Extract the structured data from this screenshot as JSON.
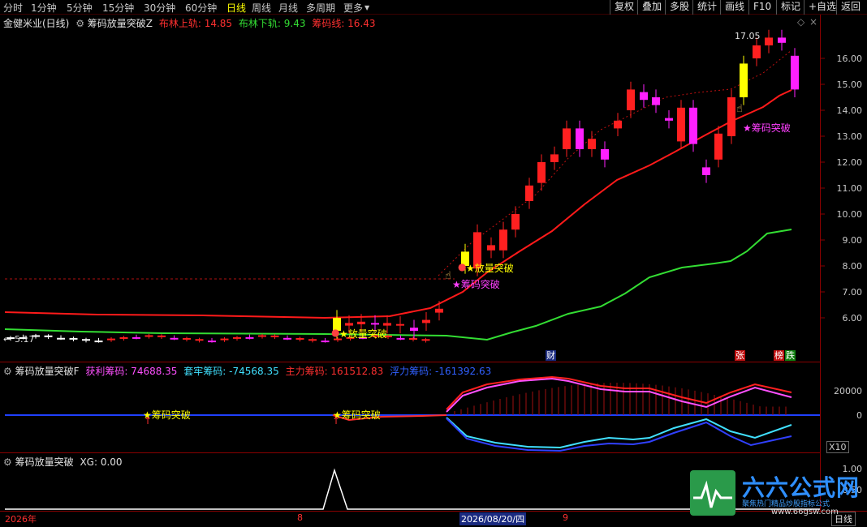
{
  "toolbar": {
    "periods": [
      "分时",
      "1分钟",
      "5分钟",
      "15分钟",
      "30分钟",
      "60分钟",
      "日线",
      "周线",
      "月线",
      "多周期",
      "更多"
    ],
    "active_period": "日线",
    "more_arrow": "▼",
    "buttons": [
      "复权",
      "叠加",
      "多股",
      "统计",
      "画线",
      "F10",
      "标记",
      "+自选",
      "返回"
    ]
  },
  "main_panel": {
    "stock_name": "金健米业(日线)",
    "indicator_name": "筹码放量突破Z",
    "upper_label": "布林上轨: 14.85",
    "lower_label": "布林下轨: 9.43",
    "chip_label": "筹码线: 16.43",
    "high_value": "17.05",
    "low_value": "5.17",
    "price_axis": [
      "16.00",
      "15.00",
      "14.00",
      "13.00",
      "12.00",
      "11.00",
      "10.00",
      "9.00",
      "8.00",
      "7.00",
      "6.00"
    ],
    "signal_volume_break": "放量突破",
    "signal_chip_break": "★筹码突破",
    "markers": {
      "cai": "财",
      "zhang": "张",
      "bang": "榜",
      "die": "跌"
    }
  },
  "panel2": {
    "indicator_name": "筹码放量突破F",
    "profit_label": "获利筹码: 74688.35",
    "trapped_label": "套牢筹码: -74568.35",
    "main_label": "主力筹码: 161512.83",
    "float_label": "浮力筹码: -161392.63",
    "axis": [
      "20000",
      "0"
    ],
    "scale": "X10",
    "signal": "★筹码突破"
  },
  "panel3": {
    "indicator_name": "筹码放量突破",
    "xg_label": "XG: 0.00",
    "axis": [
      "1.00",
      "0.50"
    ]
  },
  "bottom": {
    "dates": [
      "2026年",
      "8",
      "2026/08/20/四",
      "9"
    ],
    "period_button": "日线"
  },
  "watermark": {
    "brand": "六六公式网",
    "slogan": "聚焦热门精品炒股指标公式",
    "url": "www.66gsw.com"
  },
  "colors": {
    "up": "#ff2020",
    "down": "#ff20ff",
    "upper_band": "#ff1a1a",
    "lower_band": "#33dd33",
    "highlight": "#ffff00"
  }
}
